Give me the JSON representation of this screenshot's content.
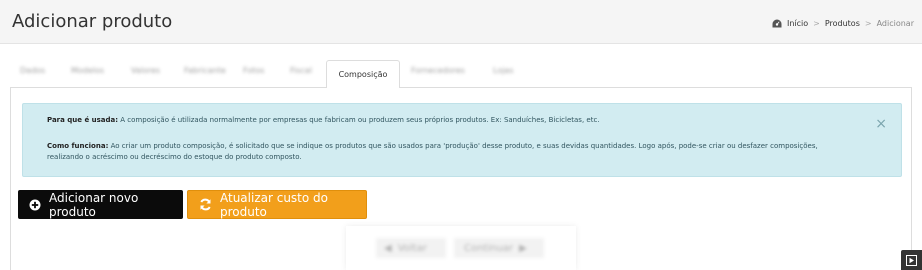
{
  "header": {
    "title": "Adicionar produto",
    "breadcrumb": {
      "home": "Início",
      "section": "Produtos",
      "current": "Adicionar",
      "separator": ">"
    }
  },
  "tabs": [
    {
      "label": "Dados"
    },
    {
      "label": "Modelos"
    },
    {
      "label": "Valores"
    },
    {
      "label": "Fabricante"
    },
    {
      "label": "Fotos"
    },
    {
      "label": "Fiscal"
    },
    {
      "label": "Composição",
      "active": true
    },
    {
      "label": "Fornecedores"
    },
    {
      "label": "Lojas"
    }
  ],
  "alert": {
    "p1_label": "Para que é usada:",
    "p1_text": " A composição é utilizada normalmente por empresas que fabricam ou produzem seus próprios produtos. Ex: Sanduíches, Bicicletas, etc.",
    "p2_label": "Como funciona:",
    "p2_text": " Ao criar um produto composição, é solicitado que se indique os produtos que são usados para 'produção' desse produto, e suas devidas quantidades. Logo após, pode-se criar ou desfazer composições, realizando o acréscimo ou decréscimo do estoque do produto composto.",
    "close": "×"
  },
  "actions": {
    "add_label": "Adicionar novo produto",
    "update_label": "Atualizar custo do produto"
  },
  "wizard": {
    "prev_label": "Voltar",
    "next_label": "Continuar"
  },
  "colors": {
    "alert_bg": "#d2ecf1",
    "add_button": "#0b0b0b",
    "update_button": "#f29f1b"
  }
}
